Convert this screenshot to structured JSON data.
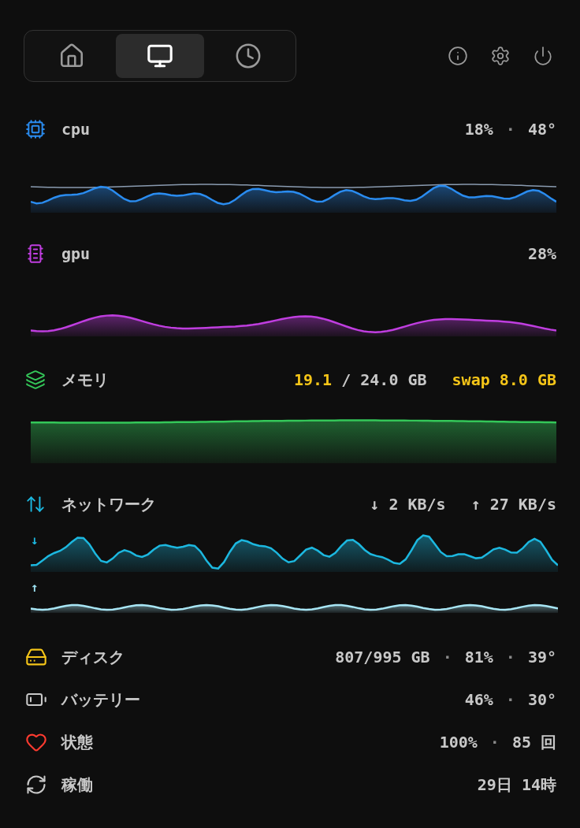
{
  "tabs": [
    {
      "kind": "home",
      "selected": false
    },
    {
      "kind": "display",
      "selected": true
    },
    {
      "kind": "clock",
      "selected": false
    }
  ],
  "sections": [
    {
      "kind": "cpu",
      "label": "cpu",
      "color": "#2a8cf0",
      "readings": [
        {
          "text": "18%"
        },
        {
          "text": "·",
          "kind": "sep"
        },
        {
          "text": "48°"
        }
      ]
    },
    {
      "kind": "gpu",
      "label": "gpu",
      "color": "#c03ee0",
      "readings": [
        {
          "text": "28%"
        }
      ]
    },
    {
      "kind": "memory",
      "label": "メモリ",
      "color": "#34c759",
      "readings": [
        {
          "text": "19.1",
          "color": "#f5c518"
        },
        {
          "text": "/ 24.0 GB"
        },
        {
          "text": "swap 8.0 GB",
          "color": "#f5c518",
          "gap": true
        }
      ]
    },
    {
      "kind": "network",
      "label": "ネットワーク",
      "color": "#1cb8e0",
      "readings": [
        {
          "text": "↓ 2 KB/s"
        },
        {
          "text": "↑ 27 KB/s",
          "gap": true
        }
      ],
      "down_mark": "↓",
      "up_mark": "↑"
    }
  ],
  "rows": [
    {
      "kind": "disk",
      "label": "ディスク",
      "readings": [
        {
          "text": "807/995 GB"
        },
        {
          "text": "·",
          "kind": "sep"
        },
        {
          "text": "81%"
        },
        {
          "text": "·",
          "kind": "sep"
        },
        {
          "text": "39°"
        }
      ]
    },
    {
      "kind": "battery",
      "label": "バッテリー",
      "readings": [
        {
          "text": "46%"
        },
        {
          "text": "·",
          "kind": "sep"
        },
        {
          "text": "30°"
        }
      ]
    },
    {
      "kind": "health",
      "label": "状態",
      "readings": [
        {
          "text": "100%"
        },
        {
          "text": "·",
          "kind": "sep"
        },
        {
          "text": "85 回"
        }
      ]
    },
    {
      "kind": "uptime",
      "label": "稼働",
      "readings": [
        {
          "text": "29日 14時"
        }
      ]
    }
  ]
}
